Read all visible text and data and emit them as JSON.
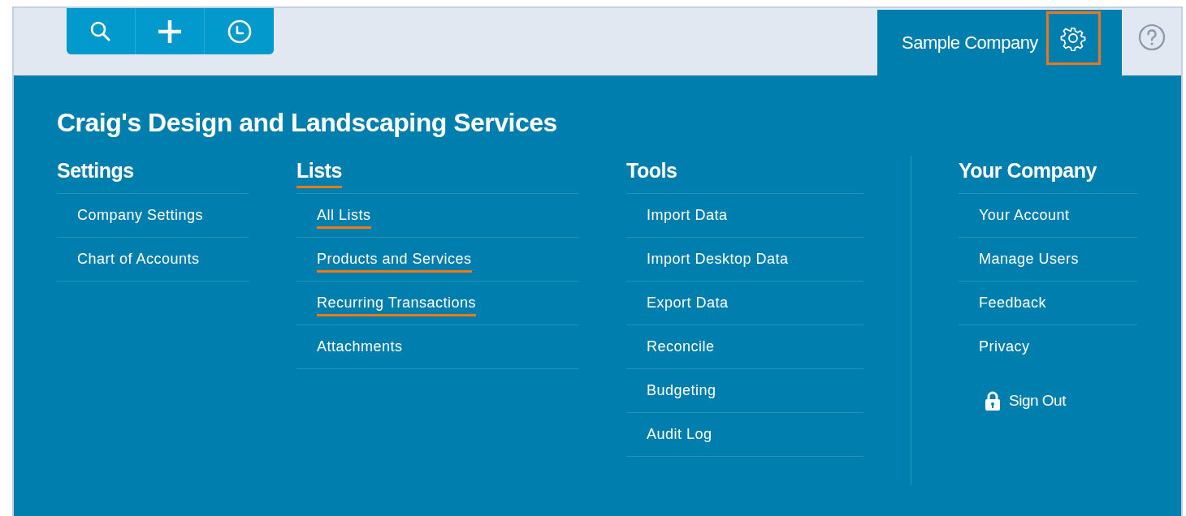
{
  "toolbar": [
    {
      "kind": "search"
    },
    {
      "kind": "add"
    },
    {
      "kind": "recent"
    }
  ],
  "company_tab": {
    "label": "Sample Company",
    "settings_highlighted": true
  },
  "title": "Craig's Design and Landscaping Services",
  "columns": [
    {
      "heading": "Settings",
      "highlighted": false,
      "items": [
        {
          "label": "Company Settings",
          "highlighted": false
        },
        {
          "label": "Chart of Accounts",
          "highlighted": false
        }
      ]
    },
    {
      "heading": "Lists",
      "highlighted": true,
      "items": [
        {
          "label": "All Lists",
          "highlighted": true
        },
        {
          "label": "Products and Services",
          "highlighted": true
        },
        {
          "label": "Recurring Transactions",
          "highlighted": true
        },
        {
          "label": "Attachments",
          "highlighted": false
        }
      ]
    },
    {
      "heading": "Tools",
      "highlighted": false,
      "items": [
        {
          "label": "Import Data",
          "highlighted": false
        },
        {
          "label": "Import Desktop Data",
          "highlighted": false
        },
        {
          "label": "Export Data",
          "highlighted": false
        },
        {
          "label": "Reconcile",
          "highlighted": false
        },
        {
          "label": "Budgeting",
          "highlighted": false
        },
        {
          "label": "Audit Log",
          "highlighted": false
        }
      ]
    },
    {
      "heading": "Your Company",
      "highlighted": false,
      "items": [
        {
          "label": "Your Account",
          "highlighted": false
        },
        {
          "label": "Manage Users",
          "highlighted": false
        },
        {
          "label": "Feedback",
          "highlighted": false
        },
        {
          "label": "Privacy",
          "highlighted": false
        }
      ]
    }
  ],
  "sign_out": "Sign Out"
}
